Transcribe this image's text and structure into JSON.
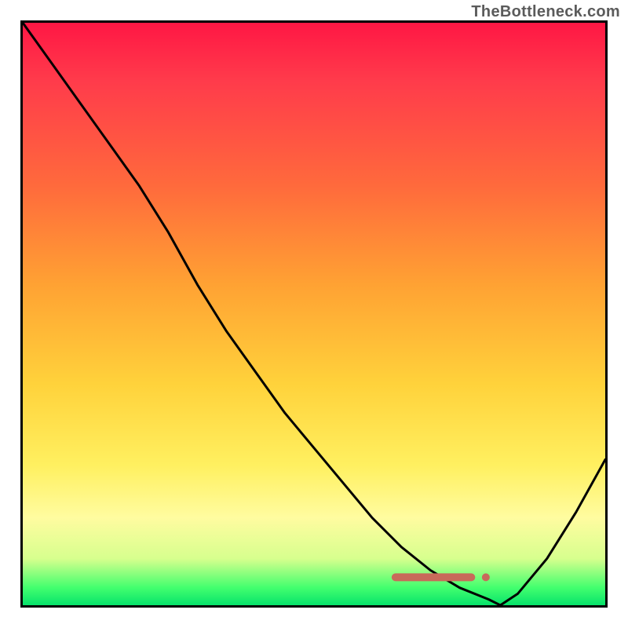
{
  "attribution": "TheBottleneck.com",
  "colors": {
    "frame": "#000000",
    "curve": "#000000",
    "marker": "#c86a5a",
    "gradient_top": "#ff1744",
    "gradient_mid1": "#ff6a3c",
    "gradient_mid2": "#ffd23b",
    "gradient_mid3": "#fffca0",
    "gradient_bottom": "#07e26b"
  },
  "marker": {
    "x_start": 0.64,
    "x_end": 0.77,
    "dot_x": 0.795,
    "y": 0.952
  },
  "chart_data": {
    "type": "line",
    "title": "",
    "xlabel": "",
    "ylabel": "",
    "xlim": [
      0,
      1
    ],
    "ylim": [
      0,
      1
    ],
    "grid": false,
    "legend": false,
    "series": [
      {
        "name": "bottleneck-curve",
        "x": [
          0.0,
          0.05,
          0.1,
          0.15,
          0.2,
          0.25,
          0.3,
          0.35,
          0.4,
          0.45,
          0.5,
          0.55,
          0.6,
          0.65,
          0.7,
          0.75,
          0.8,
          0.82,
          0.85,
          0.9,
          0.95,
          1.0
        ],
        "y": [
          1.0,
          0.93,
          0.86,
          0.79,
          0.72,
          0.64,
          0.55,
          0.47,
          0.4,
          0.33,
          0.27,
          0.21,
          0.15,
          0.1,
          0.06,
          0.03,
          0.01,
          0.0,
          0.02,
          0.08,
          0.16,
          0.25
        ]
      }
    ],
    "annotations": [
      {
        "name": "optimum-range-marker",
        "type": "horizontal-segment",
        "x_start": 0.64,
        "x_end": 0.77,
        "y": 0.048,
        "note": "y here is in data space (0 bottom, 1 top); corresponds to marker.y = 0.952 in screen space"
      }
    ]
  }
}
